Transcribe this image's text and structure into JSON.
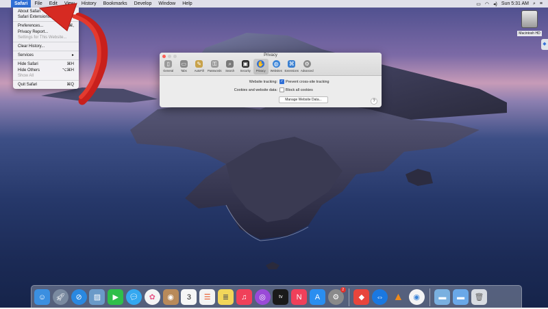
{
  "menubar": {
    "apple": "",
    "menus": [
      "Safari",
      "File",
      "Edit",
      "View",
      "History",
      "Bookmarks",
      "Develop",
      "Window",
      "Help"
    ],
    "active": "Safari",
    "clock": "Sun 5:31 AM",
    "status_icons": [
      "airplay-icon",
      "wifi-icon",
      "volume-icon",
      "search-icon",
      "control-center-icon"
    ]
  },
  "app_menu": {
    "items": [
      {
        "label": "About Safari",
        "shortcut": ""
      },
      {
        "label": "Safari Extensions...",
        "shortcut": ""
      },
      {
        "label": "Preferences...",
        "shortcut": "⌘,"
      },
      {
        "label": "Privacy Report...",
        "shortcut": ""
      },
      {
        "label": "Settings for This Website...",
        "shortcut": "",
        "disabled": true
      },
      {
        "label": "Clear History...",
        "shortcut": ""
      },
      {
        "label": "Services",
        "shortcut": "▸"
      },
      {
        "label": "Hide Safari",
        "shortcut": "⌘H"
      },
      {
        "label": "Hide Others",
        "shortcut": "⌥⌘H"
      },
      {
        "label": "Show All",
        "shortcut": "",
        "disabled": true
      },
      {
        "label": "Quit Safari",
        "shortcut": "⌘Q"
      }
    ]
  },
  "prefs_window": {
    "title": "Privacy",
    "tabs": [
      {
        "label": "General",
        "icon": "switch-icon",
        "color": "#9a9a9a"
      },
      {
        "label": "Tabs",
        "icon": "tabs-icon",
        "color": "#8a8a8a"
      },
      {
        "label": "AutoFill",
        "icon": "pencil-icon",
        "color": "#c8a24a"
      },
      {
        "label": "Passwords",
        "icon": "key-icon",
        "color": "#9a9a9a"
      },
      {
        "label": "Search",
        "icon": "magnifier-icon",
        "color": "#7a7a7a"
      },
      {
        "label": "Security",
        "icon": "padlock-icon",
        "color": "#2a2a2a"
      },
      {
        "label": "Privacy",
        "icon": "hand-icon",
        "color": "#2f6fd6"
      },
      {
        "label": "Websites",
        "icon": "globe-icon",
        "color": "#3a84d8"
      },
      {
        "label": "Extensions",
        "icon": "puzzle-icon",
        "color": "#3a7fd0"
      },
      {
        "label": "Advanced",
        "icon": "gear-icon",
        "color": "#8a8a8a"
      }
    ],
    "selected_tab": "Privacy",
    "tracking_label": "Website tracking:",
    "tracking_option": "Prevent cross-site tracking",
    "tracking_checked": true,
    "cookies_label": "Cookies and website data:",
    "cookies_option": "Block all cookies",
    "cookies_checked": false,
    "manage_button": "Manage Website Data...",
    "help": "?"
  },
  "desktop": {
    "disk_label": "Macintosh HD"
  },
  "dock": {
    "apps": [
      {
        "name": "Finder",
        "icon": "finder-icon",
        "color": "#3b8fe0"
      },
      {
        "name": "Launchpad",
        "icon": "rocket-icon",
        "color": "#7a8aa0"
      },
      {
        "name": "Safari",
        "icon": "compass-icon",
        "color": "#2a88e0"
      },
      {
        "name": "Preview",
        "icon": "photo-icon",
        "color": "#6a9ac8"
      },
      {
        "name": "FaceTime",
        "icon": "video-icon",
        "color": "#2fbf4a"
      },
      {
        "name": "Messages",
        "icon": "message-icon",
        "color": "#34a8f0"
      },
      {
        "name": "Photos",
        "icon": "flower-icon",
        "color": "#f4f4f4"
      },
      {
        "name": "Contacts",
        "icon": "contacts-icon",
        "color": "#b88a5a"
      },
      {
        "name": "Calendar",
        "icon": "calendar-icon",
        "color": "#f6f6f6",
        "text": "3"
      },
      {
        "name": "Reminders",
        "icon": "list-icon",
        "color": "#f3f3f3"
      },
      {
        "name": "Notes",
        "icon": "notes-icon",
        "color": "#f2d65a"
      },
      {
        "name": "Music",
        "icon": "music-icon",
        "color": "#f0405a"
      },
      {
        "name": "Podcasts",
        "icon": "podcast-icon",
        "color": "#9a4ad8"
      },
      {
        "name": "TV",
        "icon": "tv-icon",
        "color": "#1a1a1a",
        "text": "tv"
      },
      {
        "name": "News",
        "icon": "news-icon",
        "color": "#f0405a"
      },
      {
        "name": "App Store",
        "icon": "appstore-icon",
        "color": "#2a8ef0"
      },
      {
        "name": "System Preferences",
        "icon": "gear-icon",
        "color": "#8a8a8a",
        "badge": "2"
      },
      {
        "name": "AnyDesk",
        "icon": "anydesk-icon",
        "color": "#e8453c"
      },
      {
        "name": "TeamViewer",
        "icon": "teamviewer-icon",
        "color": "#1a78e0"
      },
      {
        "name": "VLC",
        "icon": "cone-icon",
        "color": "#f08a1a"
      },
      {
        "name": "Chrome",
        "icon": "chrome-icon",
        "color": "#f4f4f4"
      },
      {
        "name": "Folder",
        "icon": "folder-icon",
        "color": "#7ab0e0"
      },
      {
        "name": "Downloads",
        "icon": "folder-icon",
        "color": "#6aa8e8"
      },
      {
        "name": "Trash",
        "icon": "trash-icon",
        "color": "#d8dce2"
      }
    ]
  }
}
